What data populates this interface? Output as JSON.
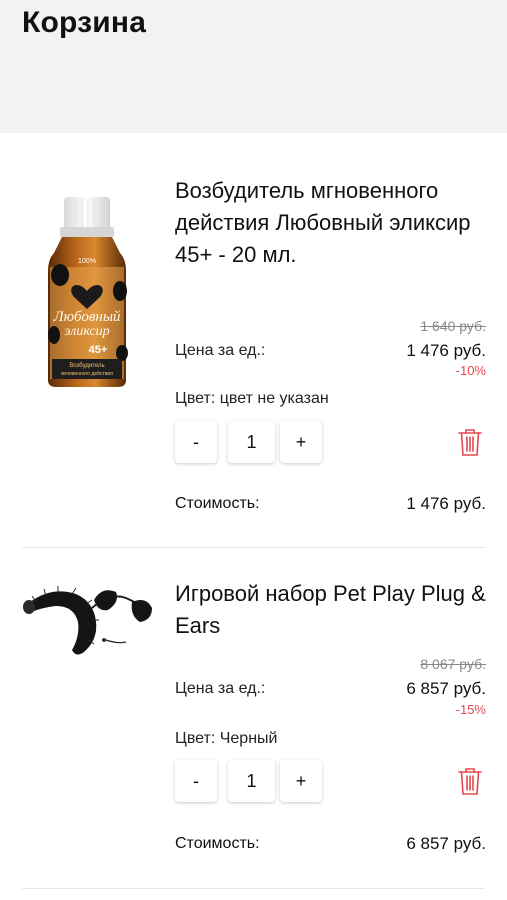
{
  "header": {
    "title": "Корзина"
  },
  "items": [
    {
      "title": "Возбудитель мгновенного действия Любовный эликсир 45+ - 20 мл.",
      "old_price": "1 640 руб.",
      "unit_label": "Цена за ед.:",
      "price": "1 476 руб.",
      "discount": "-10%",
      "color": "Цвет: цвет не указан",
      "qty_minus": "-",
      "quantity": "1",
      "qty_plus": "+",
      "cost_label": "Стоимость:",
      "cost": "1 476 руб.",
      "image": {
        "brand_lines": [
          "Любовный",
          "эликсир"
        ],
        "badge": "45+",
        "label_lines": [
          "Возбудитель",
          "мгновенного действия"
        ],
        "top_text": "100%"
      }
    },
    {
      "title": "Игровой набор Pet Play Plug & Ears",
      "old_price": "8 067 руб.",
      "unit_label": "Цена за ед.:",
      "price": "6 857 руб.",
      "discount": "-15%",
      "color": "Цвет: Черный",
      "qty_minus": "-",
      "quantity": "1",
      "qty_plus": "+",
      "cost_label": "Стоимость:",
      "cost": "6 857 руб."
    }
  ],
  "colors": {
    "header_bg": "#f2f2f4",
    "discount": "#e5484d",
    "trash": "#e5484d"
  },
  "icons": {
    "delete": "trash-icon"
  }
}
